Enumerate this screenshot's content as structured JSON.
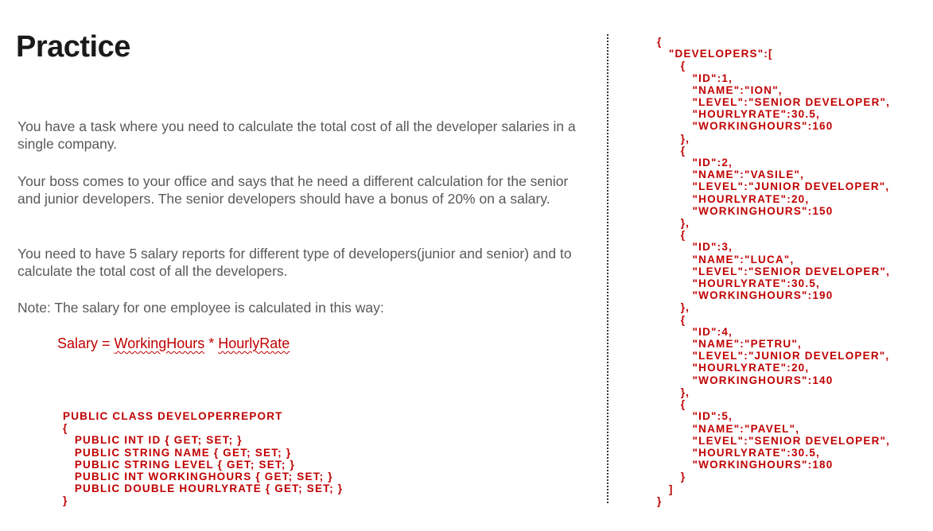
{
  "slide": {
    "title": "Practice",
    "paragraphs": [
      "You have a task where you need to calculate the total cost of all the developer salaries in a single company.",
      "Your boss comes to your office and says that he need a different calculation for the senior and junior developers. The senior developers should have a bonus of 20% on a salary.",
      "You need to have 5 salary reports for different type of developers(junior and senior) and to calculate the total cost of all the developers.",
      "Note: The salary for one employee is calculated in this way:"
    ],
    "formula": {
      "prefix": "Salary = ",
      "term1": "WorkingHours",
      "operator": " * ",
      "term2": "HourlyRate"
    },
    "class_code": "PUBLIC CLASS DEVELOPERREPORT\n{\n   PUBLIC INT ID { GET; SET; }\n   PUBLIC STRING NAME { GET; SET; }\n   PUBLIC STRING LEVEL { GET; SET; }\n   PUBLIC INT WORKINGHOURS { GET; SET; }\n   PUBLIC DOUBLE HOURLYRATE { GET; SET; }\n}",
    "json_code": "{\n   \"DEVELOPERS\":[\n      {\n         \"ID\":1,\n         \"NAME\":\"ION\",\n         \"LEVEL\":\"SENIOR DEVELOPER\",\n         \"HOURLYRATE\":30.5,\n         \"WORKINGHOURS\":160\n      },\n      {\n         \"ID\":2,\n         \"NAME\":\"VASILE\",\n         \"LEVEL\":\"JUNIOR DEVELOPER\",\n         \"HOURLYRATE\":20,\n         \"WORKINGHOURS\":150\n      },\n      {\n         \"ID\":3,\n         \"NAME\":\"LUCA\",\n         \"LEVEL\":\"SENIOR DEVELOPER\",\n         \"HOURLYRATE\":30.5,\n         \"WORKINGHOURS\":190\n      },\n      {\n         \"ID\":4,\n         \"NAME\":\"PETRU\",\n         \"LEVEL\":\"JUNIOR DEVELOPER\",\n         \"HOURLYRATE\":20,\n         \"WORKINGHOURS\":140\n      },\n      {\n         \"ID\":5,\n         \"NAME\":\"PAVEL\",\n         \"LEVEL\":\"SENIOR DEVELOPER\",\n         \"HOURLYRATE\":30.5,\n         \"WORKINGHOURS\":180\n      }\n   ]\n}"
  },
  "colors": {
    "title": "#1a1a1a",
    "body_text": "#595959",
    "code": "#c00000"
  }
}
